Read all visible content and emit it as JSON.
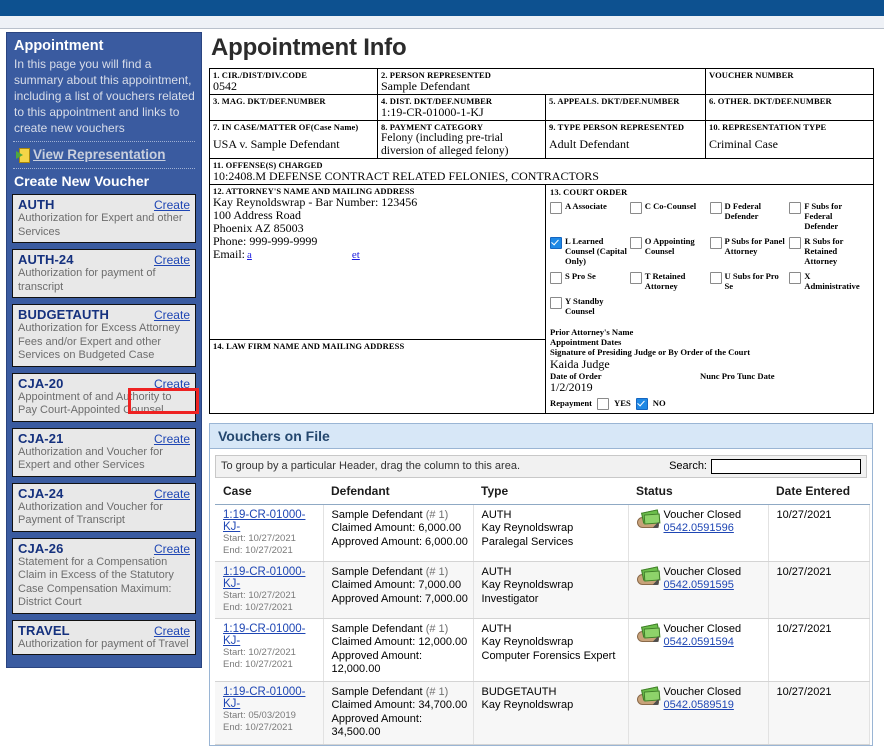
{
  "sidebar": {
    "title": "Appointment",
    "description": "In this page you will find a summary about this appointment, including a list of vouchers related to this appointment and links to create new vouchers",
    "view_representation": "View Representation",
    "create_new_voucher": "Create New Voucher",
    "create_label": "Create",
    "vouchers": [
      {
        "code": "AUTH",
        "desc": "Authorization for Expert and other Services"
      },
      {
        "code": "AUTH-24",
        "desc": "Authorization for payment of transcript"
      },
      {
        "code": "BUDGETAUTH",
        "desc": "Authorization for Excess Attorney Fees and/or Expert and other Services on Budgeted Case"
      },
      {
        "code": "CJA-20",
        "desc": "Appointment of and Authority to Pay Court-Appointed Counsel"
      },
      {
        "code": "CJA-21",
        "desc": "Authorization and Voucher for Expert and other Services"
      },
      {
        "code": "CJA-24",
        "desc": "Authorization and Voucher for Payment of Transcript"
      },
      {
        "code": "CJA-26",
        "desc": "Statement for a Compensation Claim in Excess of the Statutory Case Compensation Maximum: District Court"
      },
      {
        "code": "TRAVEL",
        "desc": "Authorization for payment of Travel"
      }
    ]
  },
  "main": {
    "page_title": "Appointment Info",
    "form": {
      "f1_label": "1. CIR./DIST/DIV.CODE",
      "f1_value": "0542",
      "f2_label": "2. PERSON REPRESENTED",
      "f2_value": "Sample Defendant",
      "voucher_number_label": "VOUCHER NUMBER",
      "voucher_number_value": "",
      "f3_label": "3. MAG. DKT/DEF.NUMBER",
      "f3_value": "",
      "f4_label": "4. DIST. DKT/DEF.NUMBER",
      "f4_value": "1:19-CR-01000-1-KJ",
      "f5_label": "5. APPEALS. DKT/DEF.NUMBER",
      "f5_value": "",
      "f6_label": "6. OTHER. DKT/DEF.NUMBER",
      "f6_value": "",
      "f7_label": "7. IN CASE/MATTER OF(Case Name)",
      "f7_value": "USA v. Sample Defendant",
      "f8_label": "8. PAYMENT CATEGORY",
      "f8_value": "Felony (including pre-trial diversion of alleged felony)",
      "f9_label": "9. TYPE PERSON REPRESENTED",
      "f9_value": "Adult Defendant",
      "f10_label": "10. REPRESENTATION TYPE",
      "f10_value": "Criminal Case",
      "f11_label": "11. OFFENSE(S) CHARGED",
      "f11_value": "10:2408.M DEFENSE CONTRACT RELATED FELONIES, CONTRACTORS",
      "f12_label": "12. ATTORNEY'S NAME AND MAILING ADDRESS",
      "f12_line1": "Kay Reynoldswrap - Bar Number: 123456",
      "f12_line2": "100 Address Road",
      "f12_line3": "Phoenix AZ 85003",
      "f12_line4": "Phone: 999-999-9999",
      "f12_email_label": "Email:",
      "f12_email_link1": "a",
      "f12_email_link2": "et",
      "f13_label": "13. COURT ORDER",
      "f14_label": "14. LAW FIRM NAME AND MAILING ADDRESS",
      "court_order_options": [
        {
          "label": "A Associate",
          "checked": false
        },
        {
          "label": "C Co-Counsel",
          "checked": false
        },
        {
          "label": "D Federal Defender",
          "checked": false
        },
        {
          "label": "F Subs for Federal Defender",
          "checked": false
        },
        {
          "label": "L Learned Counsel (Capital Only)",
          "checked": true
        },
        {
          "label": "O Appointing Counsel",
          "checked": false
        },
        {
          "label": "P Subs for Panel Attorney",
          "checked": false
        },
        {
          "label": "R Subs for Retained Attorney",
          "checked": false
        },
        {
          "label": "S Pro Se",
          "checked": false
        },
        {
          "label": "T Retained Attorney",
          "checked": false
        },
        {
          "label": "U Subs for Pro Se",
          "checked": false
        },
        {
          "label": "X Administrative",
          "checked": false
        },
        {
          "label": "Y Standby Counsel",
          "checked": false
        }
      ],
      "prior_attorney_label": "Prior Attorney's Name",
      "appointment_dates_label": "Appointment Dates",
      "signature_label": "Signature of Presiding Judge or By Order of the Court",
      "judge_name": "Kaida Judge",
      "date_of_order_label": "Date of Order",
      "nunc_pro_tunc_label": "Nunc Pro Tunc Date",
      "date_of_order_value": "1/2/2019",
      "nunc_pro_tunc_value": "",
      "repayment_label": "Repayment",
      "repayment_yes": "YES",
      "repayment_no": "NO",
      "repayment_yes_checked": false,
      "repayment_no_checked": true
    },
    "vouchers_panel": {
      "title": "Vouchers on File",
      "group_hint": "To group by a particular Header, drag the column to this area.",
      "search_label": "Search:",
      "search_value": "",
      "search_placeholder": "",
      "columns": [
        "Case",
        "Defendant",
        "Type",
        "Status",
        "Date Entered"
      ],
      "rows": [
        {
          "case_link": "1:19-CR-01000-KJ-",
          "start": "Start: 10/27/2021",
          "end": "End: 10/27/2021",
          "defendant": "Sample Defendant",
          "defendant_num": "(# 1)",
          "claimed": "Claimed Amount: 6,000.00",
          "approved": "Approved Amount: 6,000.00",
          "type": "AUTH",
          "attorney": "Kay Reynoldswrap",
          "service": "Paralegal Services",
          "status": "Voucher Closed",
          "status_link": "0542.0591596",
          "date_entered": "10/27/2021"
        },
        {
          "case_link": "1:19-CR-01000-KJ-",
          "start": "Start: 10/27/2021",
          "end": "End: 10/27/2021",
          "defendant": "Sample Defendant",
          "defendant_num": "(# 1)",
          "claimed": "Claimed Amount: 7,000.00",
          "approved": "Approved Amount: 7,000.00",
          "type": "AUTH",
          "attorney": "Kay Reynoldswrap",
          "service": "Investigator",
          "status": "Voucher Closed",
          "status_link": "0542.0591595",
          "date_entered": "10/27/2021"
        },
        {
          "case_link": "1:19-CR-01000-KJ-",
          "start": "Start: 10/27/2021",
          "end": "End: 10/27/2021",
          "defendant": "Sample Defendant",
          "defendant_num": "(# 1)",
          "claimed": "Claimed Amount: 12,000.00",
          "approved": "Approved Amount: 12,000.00",
          "type": "AUTH",
          "attorney": "Kay Reynoldswrap",
          "service": "Computer Forensics Expert",
          "status": "Voucher Closed",
          "status_link": "0542.0591594",
          "date_entered": "10/27/2021"
        },
        {
          "case_link": "1:19-CR-01000-KJ-",
          "start": "Start: 05/03/2019",
          "end": "End: 10/27/2021",
          "defendant": "Sample Defendant",
          "defendant_num": "(# 1)",
          "claimed": "Claimed Amount: 34,700.00",
          "approved": "Approved Amount: 34,500.00",
          "type": "BUDGETAUTH",
          "attorney": "Kay Reynoldswrap",
          "service": "",
          "status": "Voucher Closed",
          "status_link": "0542.0589519",
          "date_entered": "10/27/2021"
        }
      ]
    }
  }
}
